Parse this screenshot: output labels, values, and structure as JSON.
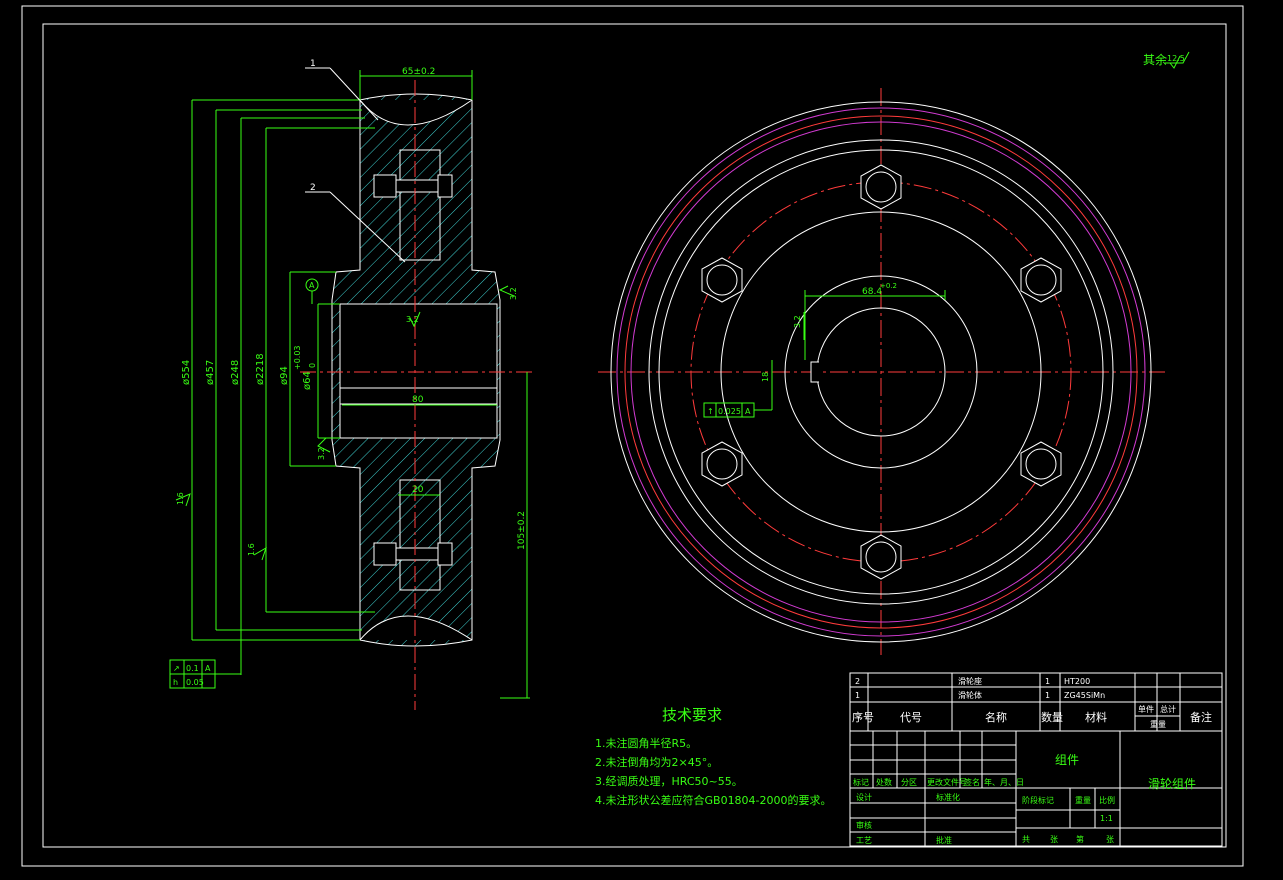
{
  "roughness_note": {
    "label": "其余",
    "value": "12.5"
  },
  "section_view": {
    "part_labels": [
      "1",
      "2"
    ],
    "dims_vertical": [
      "ø554",
      "ø457",
      "ø248",
      "ø2218",
      "ø94",
      "ø64",
      "+0.03",
      "0"
    ],
    "dims_horizontal": [
      "65±0.2",
      "80",
      "20"
    ],
    "dim_right": "105±0.2",
    "roughness": [
      "3.2",
      "3.2",
      "3.2",
      "1.6",
      "1.6"
    ],
    "datum": "A",
    "tolerance_frame": [
      {
        "symbol": "↗",
        "value": "0.1",
        "datum": "A"
      },
      {
        "symbol": "h",
        "value": "0.05",
        "datum": ""
      }
    ]
  },
  "front_view": {
    "keyway_dim": "68.4",
    "keyway_sup": "+0.2",
    "key_dim": "18",
    "key_width": "3.2",
    "tolerance_frame": {
      "value": "0.025",
      "datum": "A"
    }
  },
  "tech_requirements": {
    "title": "技术要求",
    "items": [
      "1.未注圆角半径R5。",
      "2.未注倒角均为2×45°。",
      "3.经调质处理，HRC50~55。",
      "4.未注形状公差应符合GB01804-2000的要求。"
    ]
  },
  "title_block": {
    "parts": [
      {
        "no": "2",
        "name": "滑轮座",
        "qty": "1",
        "material": "HT200"
      },
      {
        "no": "1",
        "name": "滑轮体",
        "qty": "1",
        "material": "ZG45SiMn"
      }
    ],
    "headers": {
      "no": "序号",
      "code": "代号",
      "name": "名称",
      "qty": "数量",
      "material": "材料",
      "unit": "单件",
      "total": "总计",
      "weight": "重量",
      "remark": "备注"
    },
    "center_title": "组件",
    "drawing_name": "滑轮组件",
    "rev_row": [
      "标记",
      "处数",
      "分区",
      "更改文件号",
      "签名",
      "年、月、日"
    ],
    "labels": {
      "design": "设计",
      "standard": "标准化",
      "stage": "阶段标记",
      "weight": "重量",
      "scale_label": "比例",
      "scale": "1:1",
      "review": "审核",
      "process": "工艺",
      "approve": "批准",
      "sheet_total": "共",
      "sheet": "张",
      "sheet_no": "第",
      "sheet_of": "张"
    }
  }
}
